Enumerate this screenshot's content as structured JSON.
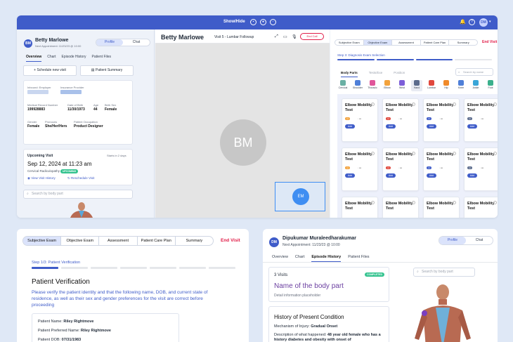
{
  "topbar": {
    "title": "Show/Hide",
    "avatar": "DM"
  },
  "left": {
    "avatar": "BM",
    "patient_name": "Betty Marlowe",
    "next_appt": "Next Appointment: 11/23/23 @ 10:00",
    "toggle": [
      "Profile",
      "Chat"
    ],
    "tabs": [
      "Overview",
      "Chart",
      "Episode History",
      "Patient Files"
    ],
    "schedule_btn": "Schedule new visit",
    "summary_btn": "Patient Summary",
    "employer_label": "Inbound: Employer",
    "insurance_label": "Insurance Provider",
    "mrn_label": "Medical Record Number",
    "mrn": "199928883",
    "dob_label": "Date of Birth",
    "dob": "11/30/1973",
    "age_label": "Age",
    "age": "44",
    "sex_label": "Birth Sex",
    "sex": "Female",
    "gender_label": "Gender",
    "gender": "Female",
    "pronouns_label": "Pronouns",
    "pronouns": "She/Her/Hers",
    "occupation_label": "Patient Occupation",
    "occupation": "Product Designer",
    "upcoming_label": "Upcoming Visit",
    "starts_in": "Starts in 2 days",
    "upcoming_date": "Sep 12, 2024 at 11:23 am",
    "upcoming_type": "Cervical Radiculopathy",
    "upcoming_badge": "UPCOMING",
    "view_history": "View Visit History",
    "reschedule": "Reschedule Visit",
    "search_placeholder": "Search by body part"
  },
  "center": {
    "name": "Betty Marlowe",
    "visit": "Visit 5 - Lumbar Followup",
    "end_call": "End Call",
    "bm": "BM",
    "em": "EM"
  },
  "right": {
    "tabs": [
      "Subjective Exam",
      "Objective Exam",
      "Assessment",
      "Patient Care Plan",
      "Summary"
    ],
    "end_visit": "End Visit",
    "step": "Step 3: Diagnosis Exam Selection",
    "subtabs": [
      "Body Parts",
      "Tests/Exe",
      "Position"
    ],
    "search_placeholder": "Search by name",
    "body_parts": [
      {
        "label": "Cervical",
        "color": "#6ab0a4"
      },
      {
        "label": "Shoulder",
        "color": "#4f7fd8"
      },
      {
        "label": "Thoracic",
        "color": "#e0569a"
      },
      {
        "label": "Elbow",
        "color": "#f2a23c"
      },
      {
        "label": "Wrist",
        "color": "#7c5ed8"
      },
      {
        "label": "Hand",
        "color": "#5b6b8c"
      },
      {
        "label": "Lumbar",
        "color": "#e0483d"
      },
      {
        "label": "Hip",
        "color": "#f08a2b"
      },
      {
        "label": "Knee",
        "color": "#4f7fd8"
      },
      {
        "label": "Ankle",
        "color": "#3aa6d8"
      },
      {
        "label": "Foot",
        "color": "#3bb08c"
      }
    ],
    "card_title": "Elbow Mobility Test",
    "add": "Add",
    "tag_colors": [
      "#f2a23c",
      "#e0483d",
      "#3f5cc9",
      "#5b6b8c"
    ]
  },
  "bottom_left": {
    "tabs": [
      "Subjective Exam",
      "Objective Exam",
      "Assessment",
      "Patient Care Plan",
      "Summary"
    ],
    "end_visit": "End Visit",
    "step": "Step 1/3: Patient Verification",
    "heading": "Patient Verification",
    "text": "Please verify the patient identity and that the following name, DOB, and current state of residence, as well as their sex and gender preferences for the visit are correct before proceeding",
    "name_label": "Patient Name:",
    "name": "Riley Rightmove",
    "pref_label": "Patient Preferred Name:",
    "pref": "Riley Rightmove",
    "dob_label": "Patient DOB:",
    "dob": "07/31/1983"
  },
  "bottom_right": {
    "avatar": "DM",
    "name": "Dipukumar Muraleedharakumar",
    "next_appt": "Next Appointment: 11/23/23 @ 10:00",
    "toggle": [
      "Profile",
      "Chat"
    ],
    "tabs": [
      "Overview",
      "Chart",
      "Episode History",
      "Patient Files"
    ],
    "visits": "3 Visits",
    "completed": "COMPLETED",
    "body_part_title": "Name of the body part",
    "detail": "Detail information placeholder",
    "search_placeholder": "Search by body part",
    "hpc_title": "History of Present Condition",
    "mechanism_label": "Mechanism of Injury:",
    "mechanism": "Gradual Onset",
    "description_label": "Description of what happened:",
    "description": "48 year old female who has a history diabetes and obesity with onset of"
  }
}
